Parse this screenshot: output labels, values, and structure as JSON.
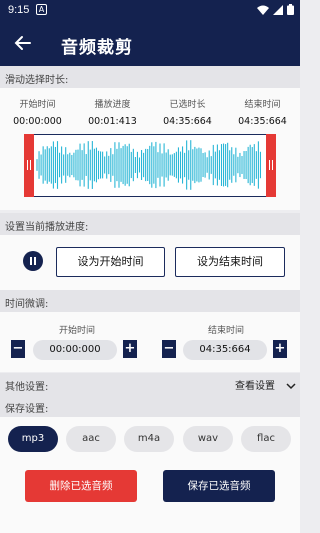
{
  "status_bar": {
    "time": "9:15",
    "notif": "A"
  },
  "app_bar": {
    "title": "音频裁剪"
  },
  "sections": {
    "slide": "滑动选择时长:",
    "progress": "设置当前播放进度:",
    "fine_tune": "时间微调:",
    "other": "其他设置:",
    "save": "保存设置:"
  },
  "stats": [
    {
      "label": "开始时间",
      "value": "00:00:000"
    },
    {
      "label": "播放进度",
      "value": "00:01:413"
    },
    {
      "label": "已选时长",
      "value": "04:35:664"
    },
    {
      "label": "结束时间",
      "value": "04:35:664"
    }
  ],
  "buttons": {
    "set_start": "设为开始时间",
    "set_end": "设为结束时间",
    "view_settings": "查看设置",
    "delete": "删除已选音频",
    "save": "保存已选音频"
  },
  "fine_tune": {
    "start_label": "开始时间",
    "start_value": "00:00:000",
    "end_label": "结束时间",
    "end_value": "04:35:664",
    "minus": "−",
    "plus": "+"
  },
  "formats": [
    "mp3",
    "aac",
    "m4a",
    "wav",
    "flac"
  ],
  "selected_format": "mp3",
  "colors": {
    "navy": "#14224f",
    "red": "#e53935",
    "wave": "#29b6d6"
  }
}
